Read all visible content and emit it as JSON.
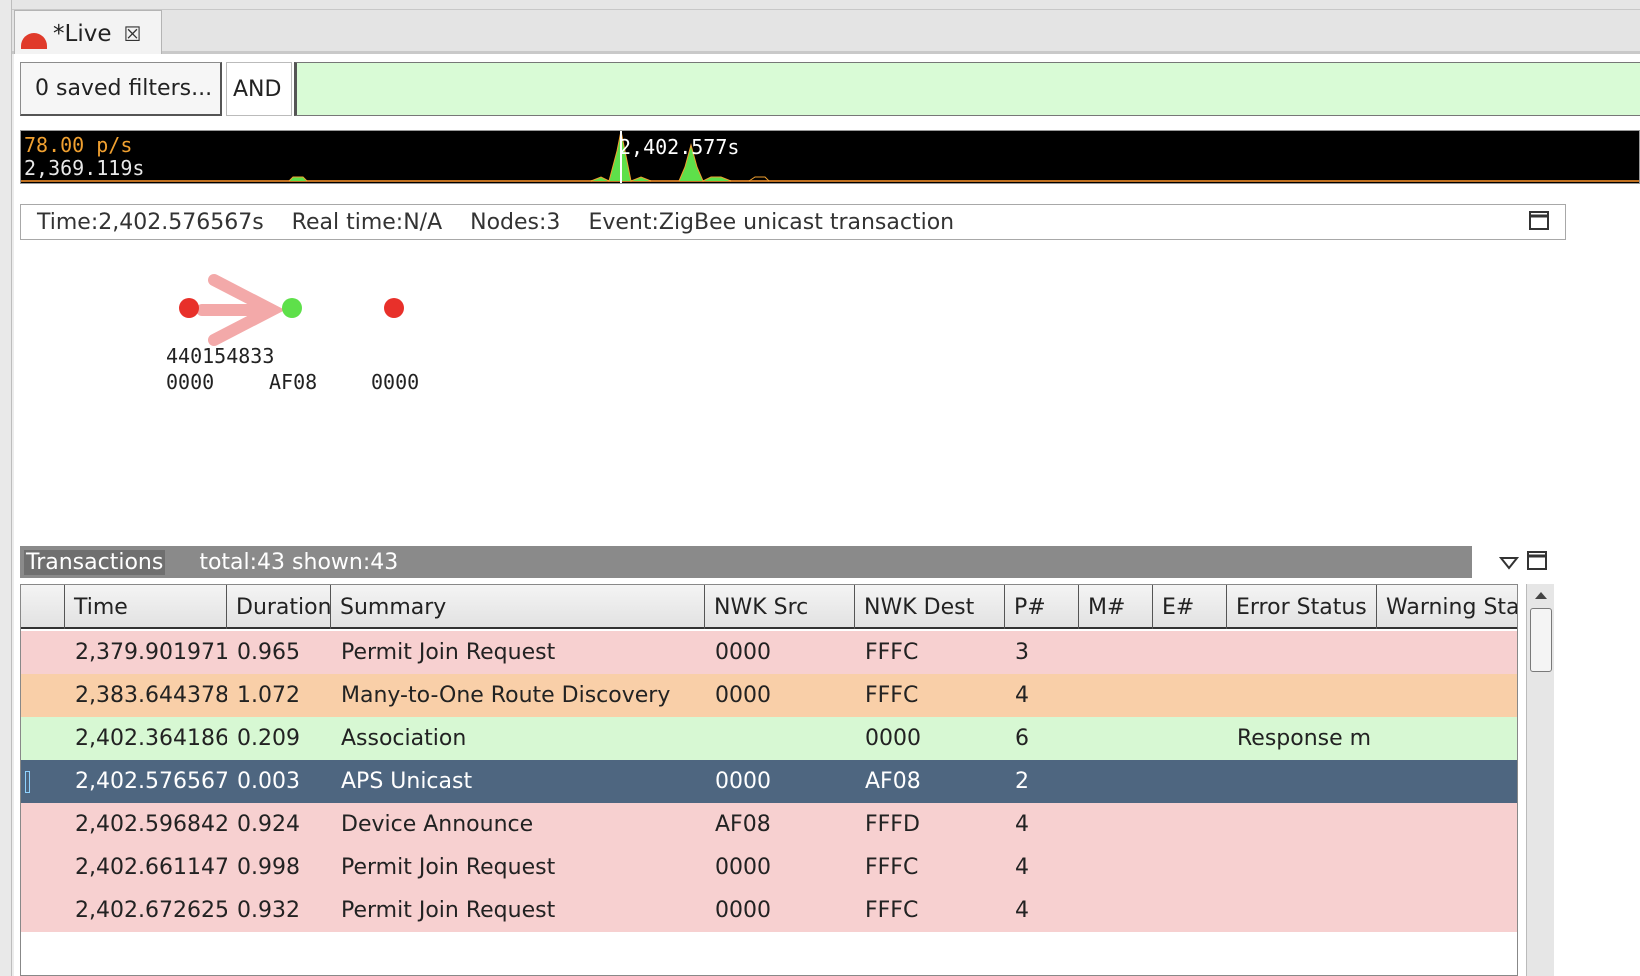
{
  "tab": {
    "title": "*Live",
    "close_glyph": "☒"
  },
  "filter": {
    "saved_label": "0 saved filters...",
    "operator": "AND",
    "value": "",
    "input_color": "#d9fbd6"
  },
  "timeline": {
    "rate": "78.00 p/s",
    "start": "2,369.119s",
    "cursor_time": "2,402.577s"
  },
  "info": {
    "time": "Time:2,402.576567s",
    "real_time": "Real time:N/A",
    "nodes": "Nodes:3",
    "event": "Event:ZigBee unicast transaction"
  },
  "graph": {
    "nodes": [
      {
        "id": "0000",
        "extra": "440154833",
        "color": "#e8302a"
      },
      {
        "id": "AF08",
        "extra": "",
        "color": "#5ee04a"
      },
      {
        "id": "0000",
        "extra": "",
        "color": "#e8302a"
      }
    ],
    "arrow_color": "#f3a9a9"
  },
  "transactions": {
    "title": "Transactions",
    "counts": "total:43 shown:43",
    "columns": [
      "",
      "Time",
      "Duration",
      "Summary",
      "NWK Src",
      "NWK Dest",
      "P#",
      "M#",
      "E#",
      "Error Status",
      "Warning Status"
    ],
    "rows": [
      {
        "time": "2,379.901971",
        "duration": "0.965",
        "summary": "Permit Join Request",
        "src": "0000",
        "dest": "FFFC",
        "p": "3",
        "m": "",
        "e": "",
        "error": "",
        "warning": "",
        "bg": "#f7d0d0",
        "fg": "#222222",
        "selected": false
      },
      {
        "time": "2,383.644378",
        "duration": "1.072",
        "summary": "Many-to-One Route Discovery",
        "src": "0000",
        "dest": "FFFC",
        "p": "4",
        "m": "",
        "e": "",
        "error": "",
        "warning": "",
        "bg": "#f9cfa8",
        "fg": "#222222",
        "selected": false
      },
      {
        "time": "2,402.364186",
        "duration": "0.209",
        "summary": "Association",
        "src": "",
        "dest": "0000",
        "p": "6",
        "m": "",
        "e": "",
        "error": "Response m",
        "warning": "",
        "bg": "#d7f8d3",
        "fg": "#222222",
        "selected": false
      },
      {
        "time": "2,402.576567",
        "duration": "0.003",
        "summary": "APS Unicast",
        "src": "0000",
        "dest": "AF08",
        "p": "2",
        "m": "",
        "e": "",
        "error": "",
        "warning": "",
        "bg": "#4e6680",
        "fg": "#ffffff",
        "selected": true
      },
      {
        "time": "2,402.596842",
        "duration": "0.924",
        "summary": "Device Announce",
        "src": "AF08",
        "dest": "FFFD",
        "p": "4",
        "m": "",
        "e": "",
        "error": "",
        "warning": "",
        "bg": "#f7d0d0",
        "fg": "#222222",
        "selected": false
      },
      {
        "time": "2,402.661147",
        "duration": "0.998",
        "summary": "Permit Join Request",
        "src": "0000",
        "dest": "FFFC",
        "p": "4",
        "m": "",
        "e": "",
        "error": "",
        "warning": "",
        "bg": "#f7d0d0",
        "fg": "#222222",
        "selected": false
      },
      {
        "time": "2,402.672625",
        "duration": "0.932",
        "summary": "Permit Join Request",
        "src": "0000",
        "dest": "FFFC",
        "p": "4",
        "m": "",
        "e": "",
        "error": "",
        "warning": "",
        "bg": "#f7d0d0",
        "fg": "#222222",
        "selected": false
      }
    ]
  },
  "icons": {
    "tab": "live-capture-icon",
    "close": "close-icon",
    "maximize": "maximize-icon",
    "menu": "dropdown-triangle-icon",
    "scroll_up": "scroll-up-arrow-icon"
  }
}
